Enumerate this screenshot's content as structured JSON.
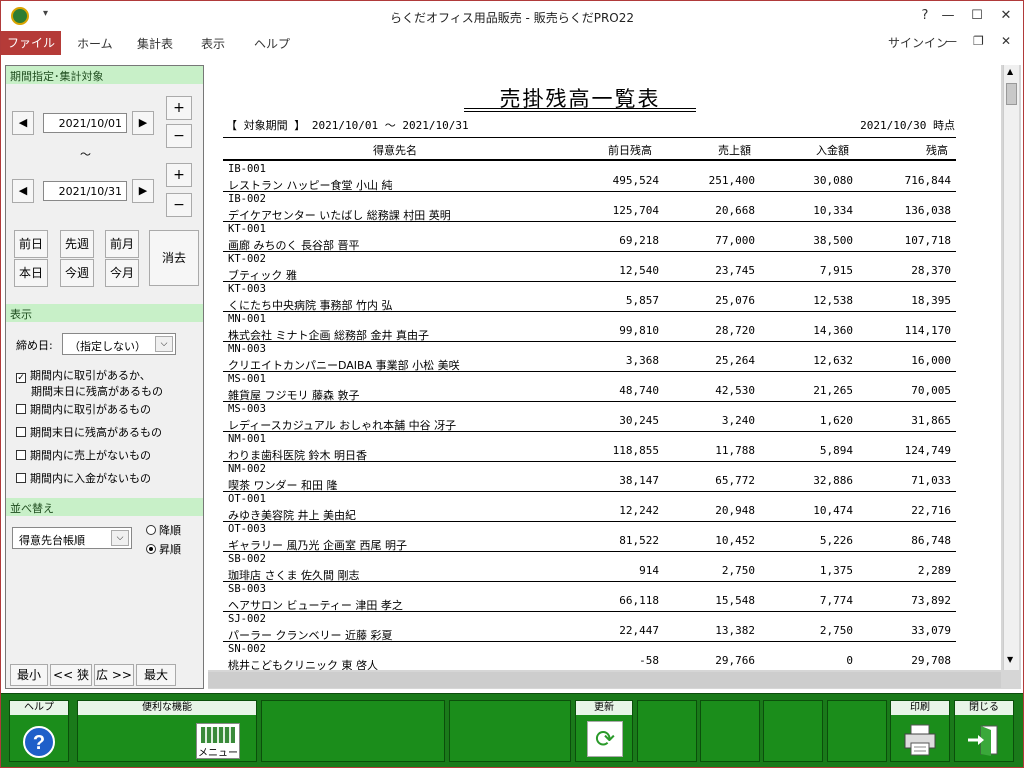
{
  "window": {
    "title": "らくだオフィス用品販売 - 販売らくだPRO22",
    "help_glyph": "?"
  },
  "menu": {
    "items": [
      "ファイル",
      "ホーム",
      "集計表",
      "表示",
      "ヘルプ"
    ],
    "signin": "サインイン"
  },
  "left_panel": {
    "period_section": "期間指定･集計対象",
    "date_from": "2021/10/01",
    "date_to": "2021/10/31",
    "tilde": "〜",
    "quick_buttons": {
      "prev_day": "前日",
      "prev_week": "先週",
      "prev_month": "前月",
      "today": "本日",
      "this_week": "今週",
      "this_month": "今月",
      "clear": "消去"
    },
    "display_section": "表示",
    "closing_day_label": "締め日:",
    "closing_day_value": "（指定しない）",
    "checkboxes": [
      {
        "label": "期間内に取引があるか、",
        "label2": "期間末日に残高があるもの",
        "checked": true
      },
      {
        "label": "期間内に取引があるもの",
        "checked": false
      },
      {
        "label": "期間末日に残高があるもの",
        "checked": false
      },
      {
        "label": "期間内に売上がないもの",
        "checked": false
      },
      {
        "label": "期間内に入金がないもの",
        "checked": false
      }
    ],
    "sort_section": "並べ替え",
    "sort_value": "得意先台帳順",
    "sort_desc": "降順",
    "sort_asc": "昇順",
    "sort_selected": "昇順",
    "zoom": {
      "min": "最小",
      "narrow": "<< 狭",
      "wide": "広 >>",
      "max": "最大"
    }
  },
  "report": {
    "title": "売掛残高一覧表",
    "period": "【 対象期間 】 2021/10/01 ～ 2021/10/31",
    "as_of": "2021/10/30 時点",
    "columns": [
      "得意先名",
      "前日残高",
      "売上額",
      "入金額",
      "残高"
    ],
    "rows": [
      {
        "code": "IB-001",
        "name": "レストラン ハッピー食堂 小山 純",
        "prev": "495,524",
        "sales": "251,400",
        "paid": "30,080",
        "balance": "716,844"
      },
      {
        "code": "IB-002",
        "name": "デイケアセンター いたばし 総務課 村田 英明",
        "prev": "125,704",
        "sales": "20,668",
        "paid": "10,334",
        "balance": "136,038"
      },
      {
        "code": "KT-001",
        "name": "画廊 みちのく 長谷部 晋平",
        "prev": "69,218",
        "sales": "77,000",
        "paid": "38,500",
        "balance": "107,718"
      },
      {
        "code": "KT-002",
        "name": "ブティック 雅",
        "prev": "12,540",
        "sales": "23,745",
        "paid": "7,915",
        "balance": "28,370"
      },
      {
        "code": "KT-003",
        "name": "くにたち中央病院 事務部 竹内 弘",
        "prev": "5,857",
        "sales": "25,076",
        "paid": "12,538",
        "balance": "18,395"
      },
      {
        "code": "MN-001",
        "name": "株式会社 ミナト企画 総務部 金井 真由子",
        "prev": "99,810",
        "sales": "28,720",
        "paid": "14,360",
        "balance": "114,170"
      },
      {
        "code": "MN-003",
        "name": "クリエイトカンパニーDAIBA 事業部 小松 美咲",
        "prev": "3,368",
        "sales": "25,264",
        "paid": "12,632",
        "balance": "16,000"
      },
      {
        "code": "MS-001",
        "name": "雑貨屋 フジモリ 藤森 敦子",
        "prev": "48,740",
        "sales": "42,530",
        "paid": "21,265",
        "balance": "70,005"
      },
      {
        "code": "MS-003",
        "name": "レディースカジュアル おしゃれ本舗 中谷 冴子",
        "prev": "30,245",
        "sales": "3,240",
        "paid": "1,620",
        "balance": "31,865"
      },
      {
        "code": "NM-001",
        "name": "わりま歯科医院 鈴木 明日香",
        "prev": "118,855",
        "sales": "11,788",
        "paid": "5,894",
        "balance": "124,749"
      },
      {
        "code": "NM-002",
        "name": "喫茶 ワンダー 和田 隆",
        "prev": "38,147",
        "sales": "65,772",
        "paid": "32,886",
        "balance": "71,033"
      },
      {
        "code": "OT-001",
        "name": "みゆき美容院 井上 美由紀",
        "prev": "12,242",
        "sales": "20,948",
        "paid": "10,474",
        "balance": "22,716"
      },
      {
        "code": "OT-003",
        "name": "ギャラリー 風乃光 企画室 西尾 明子",
        "prev": "81,522",
        "sales": "10,452",
        "paid": "5,226",
        "balance": "86,748"
      },
      {
        "code": "SB-002",
        "name": "珈琲店 さくま 佐久間 剛志",
        "prev": "914",
        "sales": "2,750",
        "paid": "1,375",
        "balance": "2,289"
      },
      {
        "code": "SB-003",
        "name": "ヘアサロン ビューティー 津田 孝之",
        "prev": "66,118",
        "sales": "15,548",
        "paid": "7,774",
        "balance": "73,892"
      },
      {
        "code": "SJ-002",
        "name": "パーラー クランベリー 近藤 彩夏",
        "prev": "22,447",
        "sales": "13,382",
        "paid": "2,750",
        "balance": "33,079"
      },
      {
        "code": "SN-002",
        "name": "桃井こどもクリニック 東 啓人",
        "prev": "-58",
        "sales": "29,766",
        "paid": "0",
        "balance": "29,708"
      }
    ]
  },
  "footer": {
    "help": "ヘルプ",
    "convenient": "便利な機能",
    "menu": "メニュー",
    "refresh": "更新",
    "print": "印刷",
    "close": "閉じる"
  }
}
